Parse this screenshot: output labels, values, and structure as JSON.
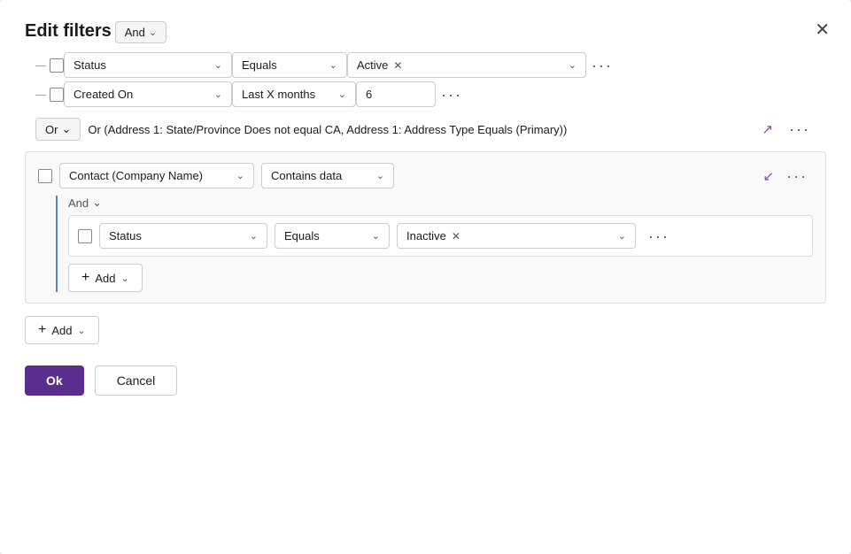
{
  "dialog": {
    "title": "Edit filters",
    "close_label": "✕"
  },
  "top_and": {
    "label": "And",
    "chevron": "⌄"
  },
  "rows": [
    {
      "id": "row1",
      "field": "Status",
      "operator": "Equals",
      "value_tag": "Active",
      "more": "···"
    },
    {
      "id": "row2",
      "field": "Created On",
      "operator": "Last X months",
      "value_num": "6",
      "more": "···"
    }
  ],
  "or_group": {
    "badge": "Or",
    "text": "Or (Address 1: State/Province Does not equal CA, Address 1: Address Type Equals (Primary))",
    "expand_icon": "↗",
    "more": "···"
  },
  "sub_group": {
    "field": "Contact (Company Name)",
    "operator": "Contains data",
    "collapse_icon": "↙",
    "more": "···",
    "and_label": "And",
    "sub_row": {
      "field": "Status",
      "operator": "Equals",
      "value_tag": "Inactive",
      "more": "···"
    },
    "add_btn": {
      "label": "Add",
      "plus": "+",
      "chevron": "⌄"
    }
  },
  "bottom_add": {
    "label": "Add",
    "plus": "+",
    "chevron": "⌄"
  },
  "footer": {
    "ok_label": "Ok",
    "cancel_label": "Cancel"
  }
}
